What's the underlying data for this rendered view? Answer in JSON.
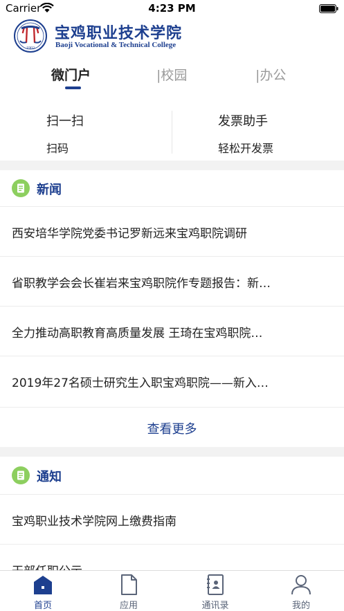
{
  "status_bar": {
    "carrier": "Carrier",
    "time": "4:23 PM"
  },
  "header": {
    "logo_year": "1902",
    "name_cn": "宝鸡职业技术学院",
    "name_en": "Baoji Vocational & Technical College"
  },
  "top_tabs": [
    {
      "label": "微门户",
      "active": true
    },
    {
      "label": "|校园",
      "active": false
    },
    {
      "label": "|办公",
      "active": false
    }
  ],
  "quick_actions": [
    {
      "title": "扫一扫",
      "subtitle": "扫码"
    },
    {
      "title": "发票助手",
      "subtitle": "轻松开发票"
    }
  ],
  "news": {
    "title": "新闻",
    "icon": "document-icon",
    "items": [
      "西安培华学院党委书记罗新远来宝鸡职院调研",
      "省职教学会会长崔岩来宝鸡职院作专题报告：新…",
      "全力推动高职教育高质量发展 王琦在宝鸡职院…",
      "2019年27名硕士研究生入职宝鸡职院——新入…"
    ],
    "more_label": "查看更多"
  },
  "notices": {
    "title": "通知",
    "icon": "document-icon",
    "items": [
      "宝鸡职业技术学院网上缴费指南",
      "干部任职公示"
    ]
  },
  "tabbar": [
    {
      "label": "首页",
      "icon": "home-icon",
      "active": true
    },
    {
      "label": "应用",
      "icon": "apps-icon",
      "active": false
    },
    {
      "label": "通讯录",
      "icon": "contacts-icon",
      "active": false
    },
    {
      "label": "我的",
      "icon": "profile-icon",
      "active": false
    }
  ],
  "colors": {
    "brand": "#1d3f8f",
    "section_icon": "#8dcf5f",
    "separator": "#f2f2f2"
  }
}
